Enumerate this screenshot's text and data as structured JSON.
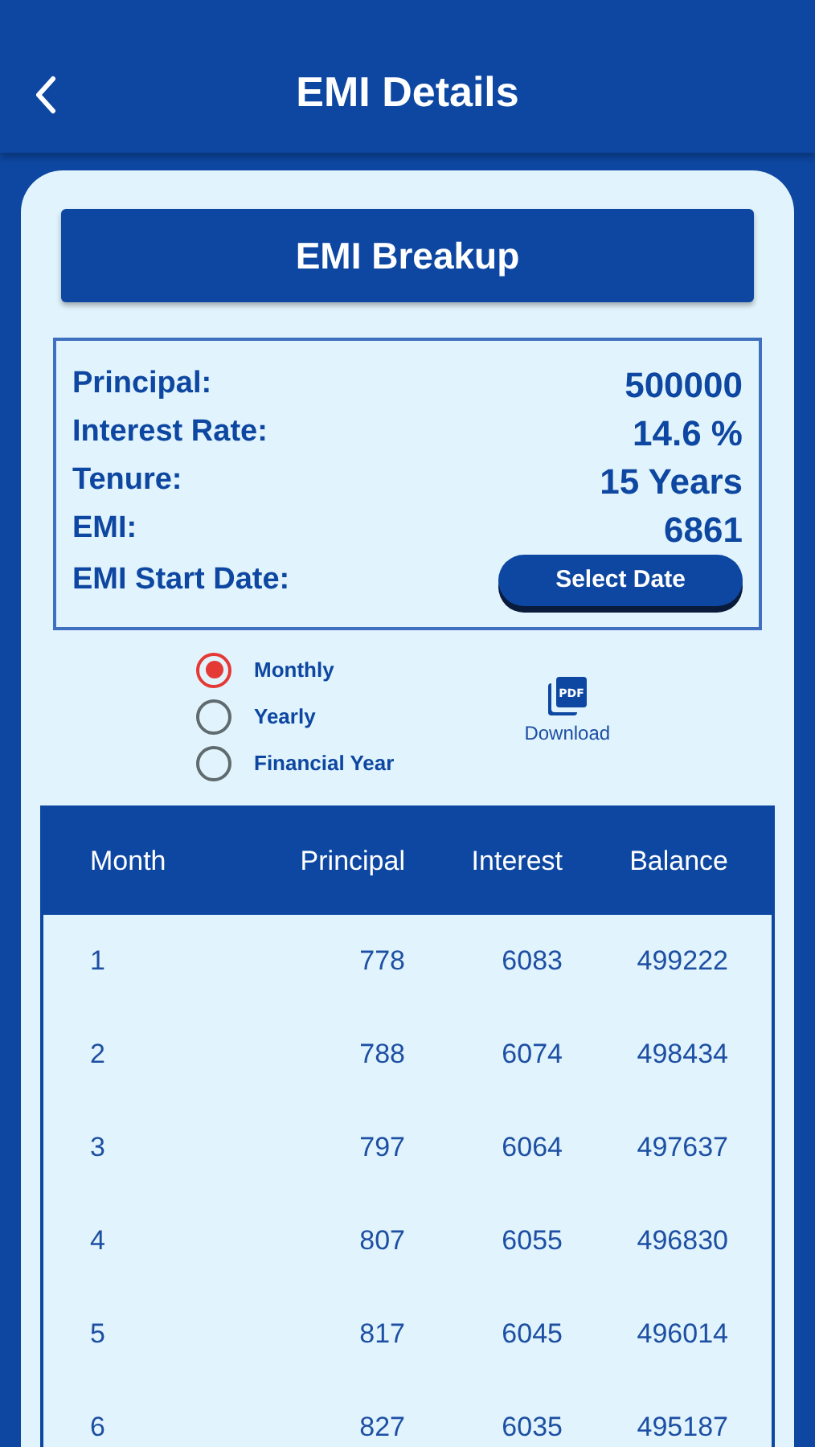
{
  "header": {
    "title": "EMI Details"
  },
  "breakup_button": "EMI Breakup",
  "summary": [
    {
      "label": "Principal:",
      "value": "500000"
    },
    {
      "label": "Interest Rate:",
      "value": "14.6 %"
    },
    {
      "label": "Tenure:",
      "value": "15 Years"
    },
    {
      "label": "EMI:",
      "value": "6861"
    }
  ],
  "start_date": {
    "label": "EMI Start Date:",
    "button": "Select Date"
  },
  "view_options": [
    {
      "label": "Monthly",
      "selected": true
    },
    {
      "label": "Yearly",
      "selected": false
    },
    {
      "label": "Financial Year",
      "selected": false
    }
  ],
  "download": {
    "icon_text": "PDF",
    "label": "Download"
  },
  "table": {
    "columns": [
      "Month",
      "Principal",
      "Interest",
      "Balance"
    ],
    "rows": [
      [
        "1",
        "778",
        "6083",
        "499222"
      ],
      [
        "2",
        "788",
        "6074",
        "498434"
      ],
      [
        "3",
        "797",
        "6064",
        "497637"
      ],
      [
        "4",
        "807",
        "6055",
        "496830"
      ],
      [
        "5",
        "817",
        "6045",
        "496014"
      ],
      [
        "6",
        "827",
        "6035",
        "495187"
      ]
    ]
  }
}
